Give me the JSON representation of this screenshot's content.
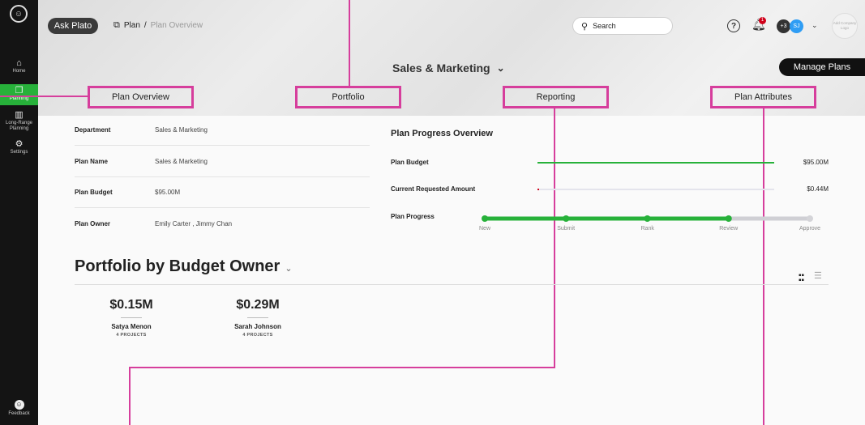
{
  "sidebar": {
    "items": [
      {
        "label": "Home",
        "icon": "home-icon"
      },
      {
        "label": "Planning",
        "icon": "planning-icon",
        "active": true
      },
      {
        "label": "Long-Range Planning",
        "icon": "map-icon"
      },
      {
        "label": "Settings",
        "icon": "gear-icon"
      }
    ],
    "feedback_label": "Feedback"
  },
  "header": {
    "ask_plato": "Ask Plato",
    "breadcrumb": {
      "root": "Plan",
      "separator": "/",
      "current": "Plan Overview"
    },
    "search_placeholder": "Search",
    "notification_count": "1",
    "avatar_more": "+3",
    "avatar_initials": "SJ",
    "company_logo_text": "Add Company Logo"
  },
  "plan_selector": "Sales & Marketing",
  "manage_plans": "Manage Plans",
  "tabs": [
    {
      "label": "Plan Overview"
    },
    {
      "label": "Portfolio"
    },
    {
      "label": "Reporting"
    },
    {
      "label": "Plan Attributes"
    }
  ],
  "details": [
    {
      "label": "Department",
      "value": "Sales & Marketing"
    },
    {
      "label": "Plan Name",
      "value": "Sales & Marketing"
    },
    {
      "label": "Plan Budget",
      "value": "$95.00M"
    },
    {
      "label": "Plan Owner",
      "value": "Emily Carter , Jimmy Chan"
    }
  ],
  "progress_overview": {
    "title": "Plan Progress Overview",
    "bars": [
      {
        "label": "Plan Budget",
        "value": "$95.00M",
        "fraction": 1.0,
        "color": "#27b13a"
      },
      {
        "label": "Current Requested Amount",
        "value": "$0.44M",
        "fraction": 0.005,
        "color": "#d0021b"
      }
    ],
    "progress_label": "Plan Progress",
    "stages": [
      "New",
      "Submit",
      "Rank",
      "Review",
      "Approve"
    ],
    "completed_stages": 4
  },
  "portfolio": {
    "title": "Portfolio by Budget Owner",
    "owners": [
      {
        "amount": "$0.15M",
        "name": "Satya Menon",
        "projects": "4 PROJECTS"
      },
      {
        "amount": "$0.29M",
        "name": "Sarah Johnson",
        "projects": "4 PROJECTS"
      }
    ]
  },
  "colors": {
    "accent_green": "#27b13a",
    "annotation_pink": "#d63e9c",
    "sidebar_bg": "#141414"
  }
}
